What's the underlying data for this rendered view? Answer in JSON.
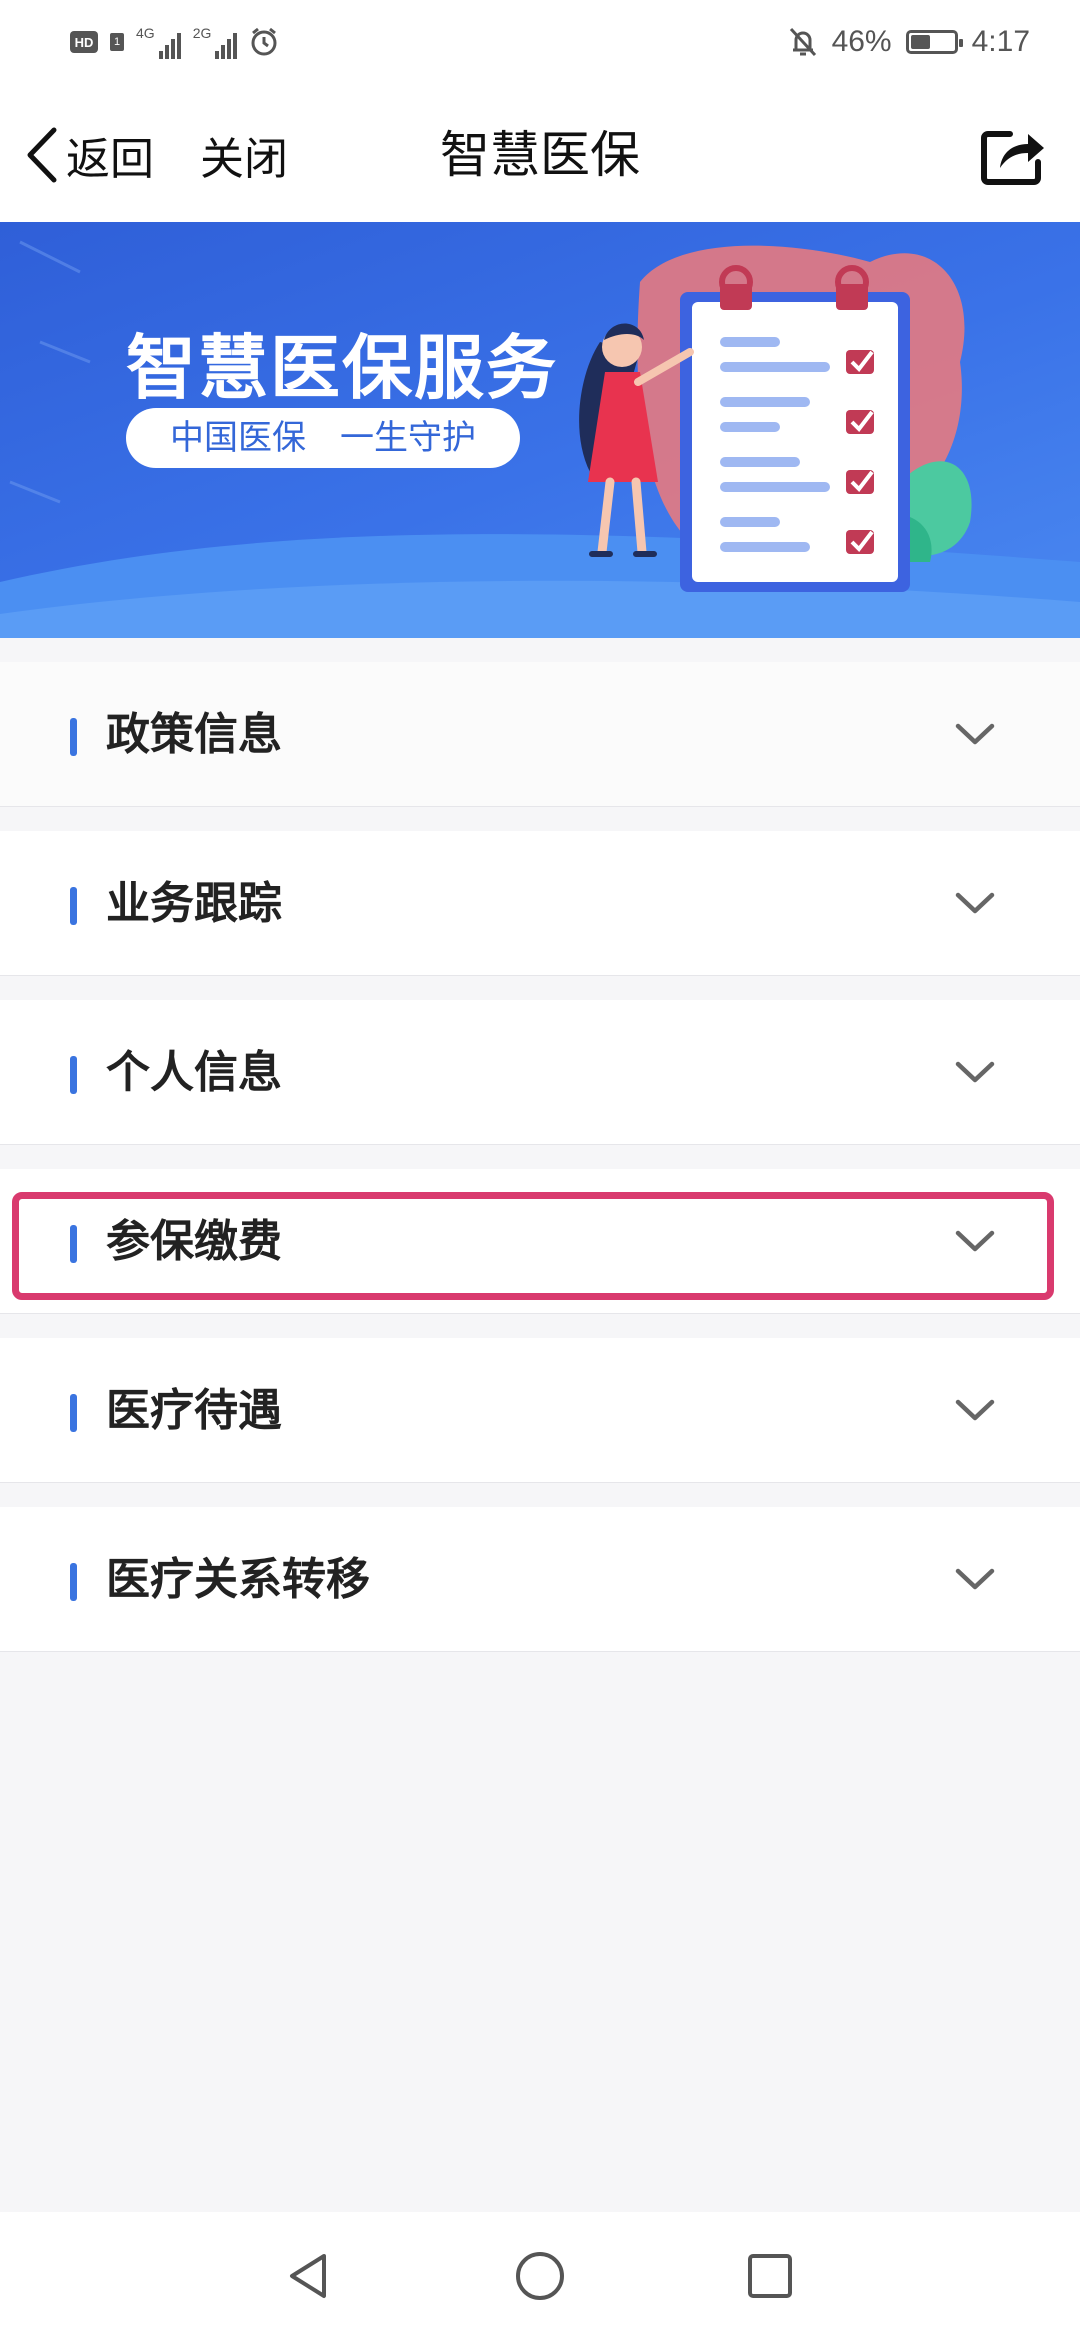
{
  "status_bar": {
    "hd": "HD",
    "sim": "1",
    "net1": "4G",
    "net2": "2G",
    "battery_percent": "46%",
    "battery_level": 0.46,
    "time": "4:17"
  },
  "nav": {
    "back_label": "返回",
    "close_label": "关闭",
    "title": "智慧医保"
  },
  "banner": {
    "title": "智慧医保服务",
    "slogan": "中国医保　一生守护"
  },
  "menu": {
    "items": [
      {
        "label": "政策信息"
      },
      {
        "label": "业务跟踪"
      },
      {
        "label": "个人信息"
      },
      {
        "label": "参保缴费"
      },
      {
        "label": "医疗待遇"
      },
      {
        "label": "医疗关系转移"
      }
    ],
    "highlighted_index": 3
  },
  "colors": {
    "accent": "#3a74e0",
    "banner_blue": "#3467d8",
    "highlight": "#d93a6e"
  },
  "icons": [
    "chevron-left-icon",
    "share-icon",
    "chevron-down-icon",
    "alarm-icon",
    "mute-icon",
    "battery-icon",
    "back-triangle-icon",
    "home-circle-icon",
    "recents-square-icon"
  ]
}
